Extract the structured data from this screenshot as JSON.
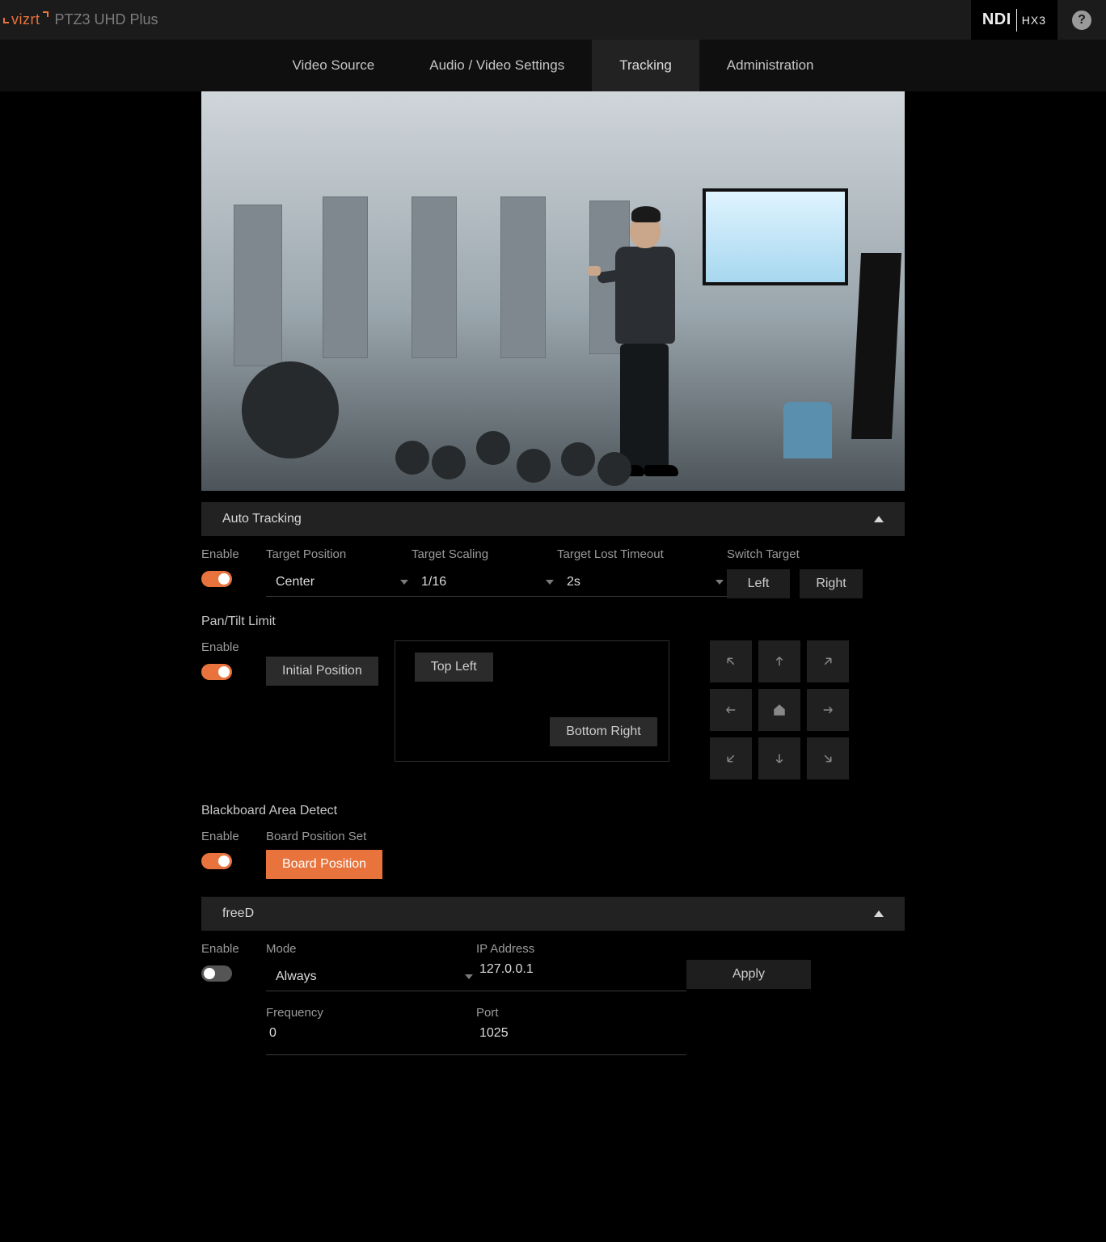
{
  "header": {
    "logo_text": "vizrt",
    "product": "PTZ3 UHD Plus",
    "ndi_label": "NDI",
    "hx3_label": "HX3",
    "help_glyph": "?"
  },
  "nav": {
    "tabs": [
      {
        "label": "Video Source",
        "active": false
      },
      {
        "label": "Audio / Video Settings",
        "active": false
      },
      {
        "label": "Tracking",
        "active": true
      },
      {
        "label": "Administration",
        "active": false
      }
    ]
  },
  "auto_tracking": {
    "section_title": "Auto Tracking",
    "enable_label": "Enable",
    "enable_state": true,
    "target_position_label": "Target Position",
    "target_position_value": "Center",
    "target_scaling_label": "Target Scaling",
    "target_scaling_value": "1/16",
    "target_lost_label": "Target Lost Timeout",
    "target_lost_value": "2s",
    "switch_target_label": "Switch Target",
    "switch_left": "Left",
    "switch_right": "Right"
  },
  "pantilt": {
    "title": "Pan/Tilt Limit",
    "enable_label": "Enable",
    "enable_state": true,
    "initial_btn": "Initial Position",
    "top_left_btn": "Top Left",
    "bottom_right_btn": "Bottom Right"
  },
  "blackboard": {
    "title": "Blackboard Area Detect",
    "enable_label": "Enable",
    "enable_state": true,
    "board_set_label": "Board Position Set",
    "board_btn": "Board Position"
  },
  "freed": {
    "section_title": "freeD",
    "enable_label": "Enable",
    "enable_state": false,
    "mode_label": "Mode",
    "mode_value": "Always",
    "ip_label": "IP Address",
    "ip_value": "127.0.0.1",
    "freq_label": "Frequency",
    "freq_value": "0",
    "port_label": "Port",
    "port_value": "1025",
    "apply_btn": "Apply"
  }
}
